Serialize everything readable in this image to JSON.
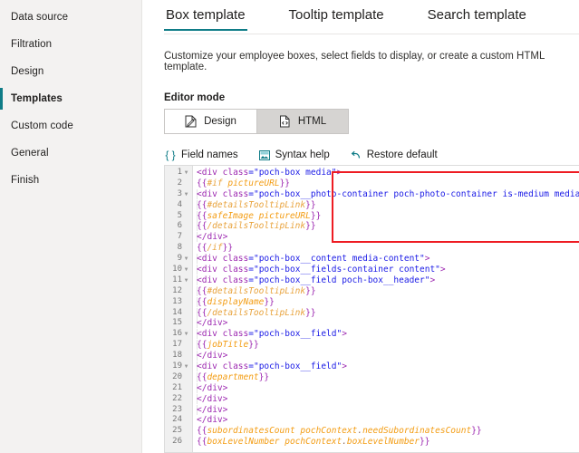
{
  "sidebar": {
    "items": [
      {
        "label": "Data source",
        "active": false
      },
      {
        "label": "Filtration",
        "active": false
      },
      {
        "label": "Design",
        "active": false
      },
      {
        "label": "Templates",
        "active": true
      },
      {
        "label": "Custom code",
        "active": false
      },
      {
        "label": "General",
        "active": false
      },
      {
        "label": "Finish",
        "active": false
      }
    ]
  },
  "tabs": [
    {
      "label": "Box template",
      "active": true
    },
    {
      "label": "Tooltip template",
      "active": false
    },
    {
      "label": "Search template",
      "active": false
    }
  ],
  "description": "Customize your employee boxes, select fields to display, or create a custom HTML template.",
  "editor_mode": {
    "label": "Editor mode",
    "options": [
      {
        "label": "Design",
        "icon": "design-document-icon",
        "selected": false
      },
      {
        "label": "HTML",
        "icon": "html-document-icon",
        "selected": true
      }
    ]
  },
  "code_toolbar": [
    {
      "label": "Field names",
      "icon": "braces-icon"
    },
    {
      "label": "Syntax help",
      "icon": "image-help-icon"
    },
    {
      "label": "Restore default",
      "icon": "undo-icon"
    }
  ],
  "colors": {
    "accent": "#0f7c87",
    "annotation": "#ee1c23",
    "sidebar_bg": "#f3f2f1",
    "gutter_bg": "#f0f0f0",
    "tag": "#9c27b0",
    "string": "#1a1ae6",
    "variable": "#f39c12",
    "keyword": "#e8a33d"
  },
  "editor": {
    "line_count": 26,
    "fold_lines": [
      1,
      3,
      9,
      10,
      11,
      16,
      19
    ],
    "lines": [
      "<div class=\"poch-box media\">",
      "{{#if pictureURL}}",
      "    <div class=\"poch-box__photo-container poch-photo-container is-medium media-left\"",
      "        {{#detailsTooltipLink}}",
      "            {{safeImage pictureURL}}",
      "        {{/detailsTooltipLink}}",
      "    </div>",
      "{{/if}}",
      "    <div class=\"poch-box__content media-content\">",
      "        <div class=\"poch-box__fields-container content\">",
      "            <div class=\"poch-box__field poch-box__header\">",
      "                {{#detailsTooltipLink}}",
      "                    {{displayName}}",
      "                {{/detailsTooltipLink}}",
      "            </div>",
      "            <div class=\"poch-box__field\">",
      "                {{jobTitle}}",
      "            </div>",
      "            <div class=\"poch-box__field\">",
      "                {{department}}",
      "            </div>",
      "        </div>",
      "    </div>",
      "</div>",
      "{{subordinatesCount pochContext.needSubordinatesCount}}",
      "{{boxLevelNumber pochContext.boxLevelNumber}}"
    ]
  },
  "annotation": {
    "type": "highlight-rectangle",
    "color": "#ee1c23",
    "covers_lines": "2-8"
  }
}
